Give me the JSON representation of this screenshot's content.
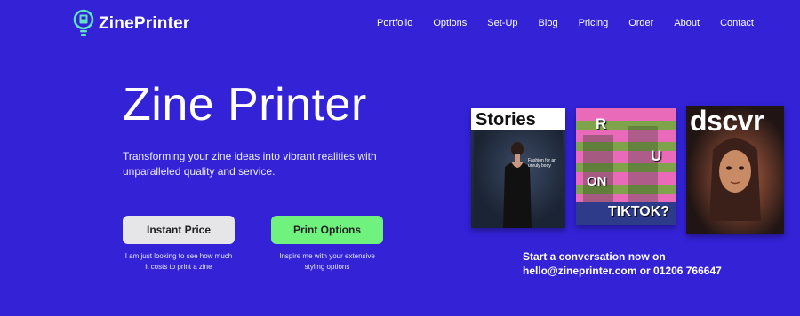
{
  "brand": {
    "name": "ZinePrinter"
  },
  "nav": {
    "items": [
      {
        "label": "Portfolio"
      },
      {
        "label": "Options"
      },
      {
        "label": "Set-Up"
      },
      {
        "label": "Blog"
      },
      {
        "label": "Pricing"
      },
      {
        "label": "Order"
      },
      {
        "label": "About"
      },
      {
        "label": "Contact"
      }
    ]
  },
  "hero": {
    "title": "Zine Printer",
    "subtitle": "Transforming your zine ideas into vibrant realities with unparalleled quality and service."
  },
  "cta": {
    "instant": {
      "label": "Instant Price",
      "caption": "I am just looking to see how much it costs to print a zine"
    },
    "print": {
      "label": "Print Options",
      "caption": "Inspire me with your extensive styling options"
    }
  },
  "magazines": {
    "stories": {
      "title": "Stories",
      "tagline": "Fashion for an unruly body"
    },
    "tiktok": {
      "words": [
        "R",
        "U",
        "ON",
        "TIKTOK?"
      ]
    },
    "dscvr": {
      "title": "dscvr"
    }
  },
  "contact": {
    "line1": "Start a conversation now on",
    "line2": "hello@zineprinter.com or 01206 766647"
  },
  "colors": {
    "background": "#3322d6",
    "accent_green": "#6ff27e",
    "logo_teal": "#5fe3c0"
  }
}
